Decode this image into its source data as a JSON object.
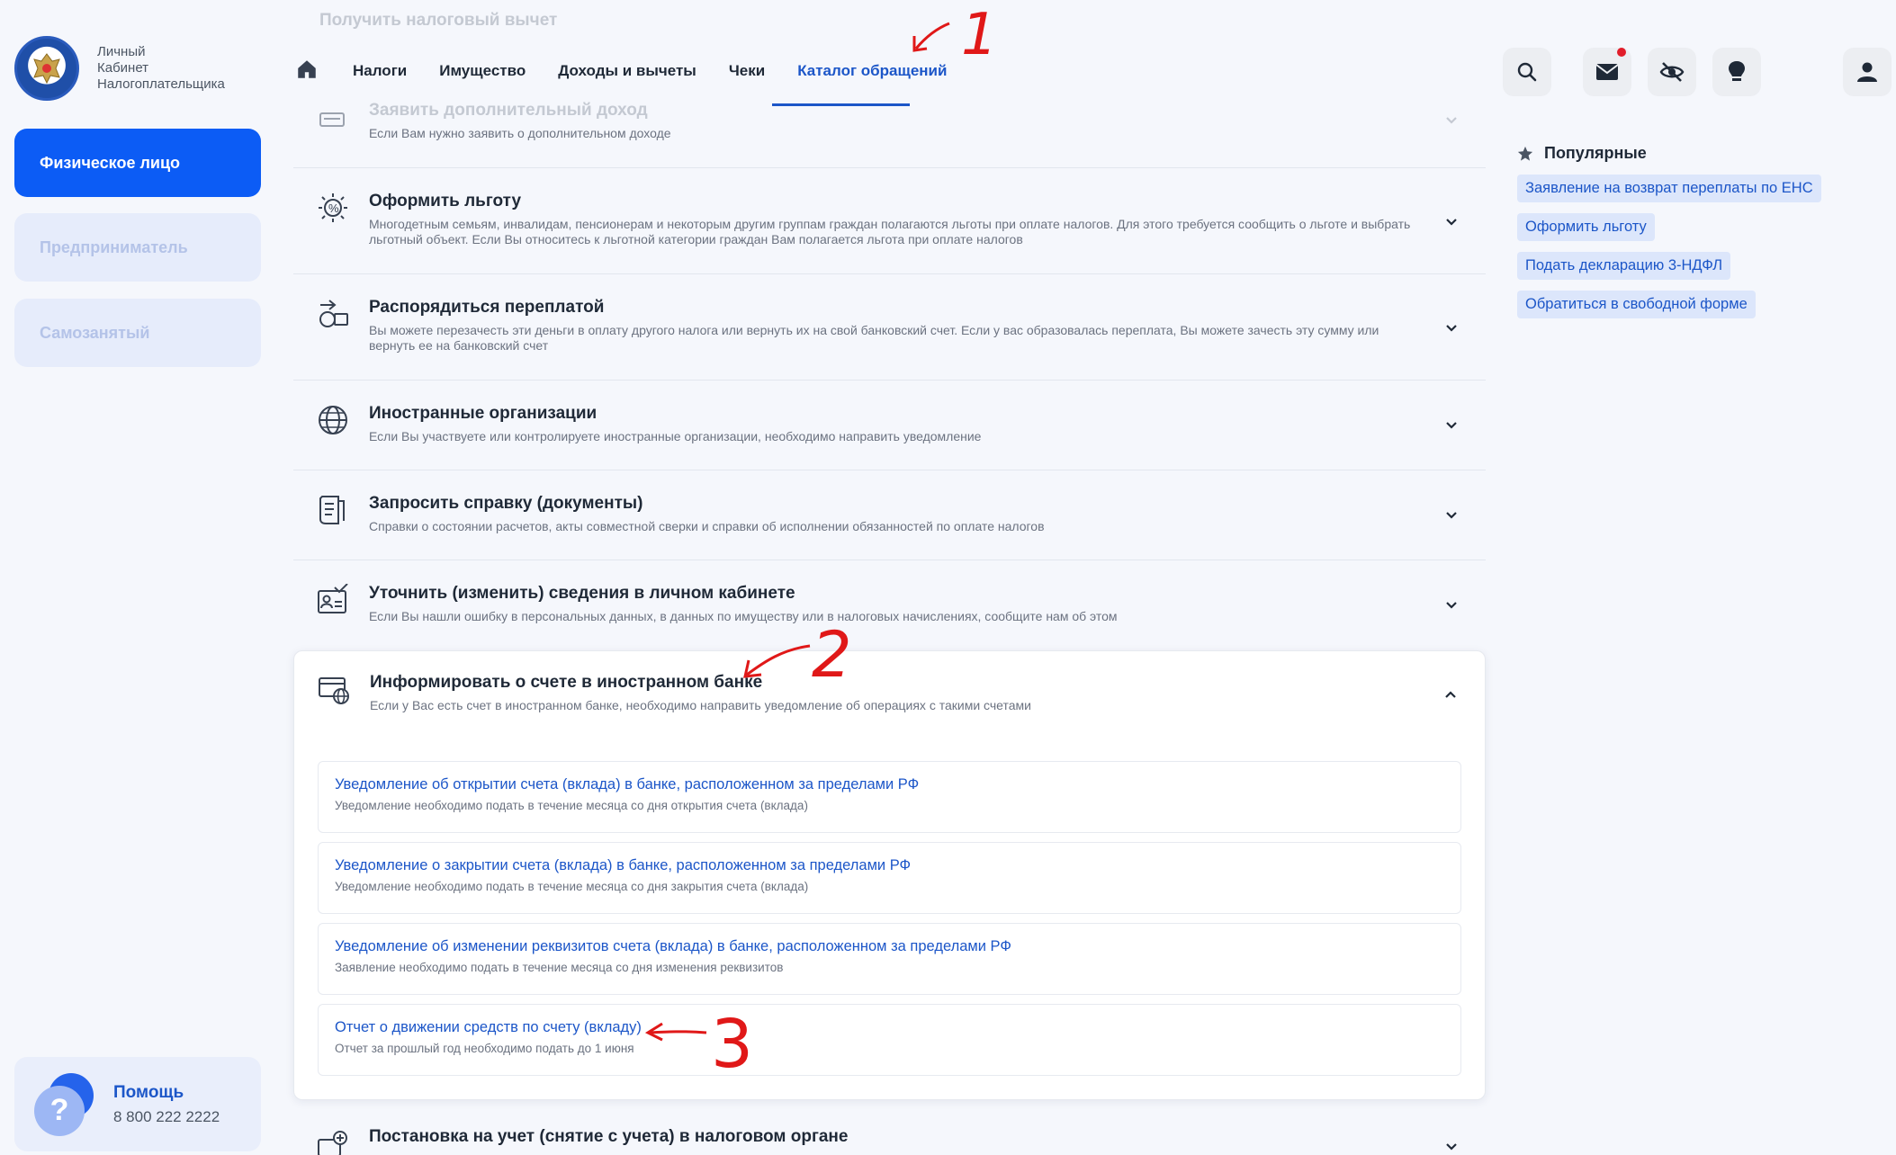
{
  "logo": {
    "lines": [
      "Личный",
      "Кабинет",
      "Налогоплательщика"
    ]
  },
  "sidebar": {
    "categories": [
      {
        "label": "Физическое лицо",
        "active": true
      },
      {
        "label": "Предприниматель",
        "active": false
      },
      {
        "label": "Самозанятый",
        "active": false
      }
    ],
    "help": {
      "title": "Помощь",
      "phone": "8 800 222 2222"
    }
  },
  "header": {
    "faded_top_item": "Получить налоговый вычет",
    "nav": [
      "Налоги",
      "Имущество",
      "Доходы и вычеты",
      "Чеки",
      "Каталог обращений"
    ],
    "active_nav": "Каталог обращений",
    "icons": [
      "search-icon",
      "mail-icon",
      "eye-off-icon",
      "bulb-icon",
      "user-icon"
    ]
  },
  "rows": [
    {
      "title": "Заявить дополнительный доход",
      "desc": "Если Вам нужно заявить о дополнительном доходе"
    },
    {
      "title": "Оформить льготу",
      "desc": "Многодетным семьям, инвалидам, пенсионерам и некоторым другим группам граждан полагаются льготы при оплате налогов. Для этого требуется сообщить о льготе и выбрать льготный объект. Если Вы относитесь к льготной категории граждан Вам полагается льгота при оплате налогов"
    },
    {
      "title": "Распорядиться переплатой",
      "desc": "Вы можете перезачесть эти деньги в оплату другого налога или вернуть их на свой банковский счет. Если у вас образовалась переплата, Вы можете зачесть эту сумму или вернуть ее на банковский счет"
    },
    {
      "title": "Иностранные организации",
      "desc": "Если Вы участвуете или контролируете иностранные организации, необходимо направить уведомление"
    },
    {
      "title": "Запросить справку (документы)",
      "desc": "Справки о состоянии расчетов, акты совместной сверки и справки об исполнении обязанностей по оплате налогов"
    },
    {
      "title": "Уточнить (изменить) сведения в личном кабинете",
      "desc": "Если Вы нашли ошибку в персональных данных, в данных по имуществу или в налоговых начислениях, сообщите нам об этом"
    }
  ],
  "expanded": {
    "title": "Информировать о счете в иностранном банке",
    "desc": "Если у Вас есть счет в иностранном банке, необходимо направить уведомление об операциях с такими счетами",
    "items": [
      {
        "title": "Уведомление об открытии счета (вклада) в банке, расположенном за пределами РФ",
        "desc": "Уведомление необходимо подать в течение месяца со дня открытия счета (вклада)"
      },
      {
        "title": "Уведомление о закрытии счета (вклада) в банке, расположенном за пределами РФ",
        "desc": "Уведомление необходимо подать в течение месяца со дня закрытия счета (вклада)"
      },
      {
        "title": "Уведомление об изменении реквизитов счета (вклада) в банке, расположенном за пределами РФ",
        "desc": "Заявление необходимо подать в течение месяца со дня изменения реквизитов"
      },
      {
        "title": "Отчет о движении средств по счету (вкладу)",
        "desc": "Отчет за прошлый год необходимо подать до 1 июня"
      }
    ]
  },
  "last_row": {
    "title": "Постановка на учет (снятие с учета) в налоговом органе"
  },
  "popular": {
    "title": "Популярные",
    "items": [
      "Заявление на возврат переплаты по ЕНС",
      "Оформить льготу",
      "Подать декларацию 3-НДФЛ",
      "Обратиться в свободной форме"
    ]
  },
  "annotations": {
    "one": "1",
    "two": "2",
    "three": "3",
    "color": "#e01818"
  }
}
